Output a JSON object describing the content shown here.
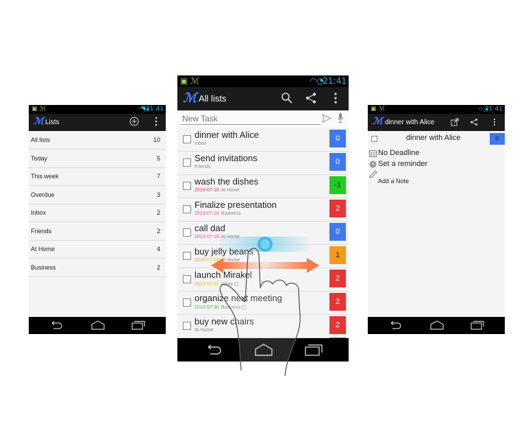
{
  "left_screen": {
    "status": {
      "time": "21:41"
    },
    "actionbar": {
      "title": "Lists"
    },
    "lists": [
      {
        "name": "All lists",
        "count": "10"
      },
      {
        "name": "Today",
        "count": "5"
      },
      {
        "name": "This week",
        "count": "7"
      },
      {
        "name": "Overdue",
        "count": "3"
      },
      {
        "name": "Inbox",
        "count": "2"
      },
      {
        "name": "Friends",
        "count": "2"
      },
      {
        "name": "At Home",
        "count": "4"
      },
      {
        "name": "Business",
        "count": "2"
      }
    ]
  },
  "center_screen": {
    "status": {
      "time": "21:41"
    },
    "actionbar": {
      "title": "All lists"
    },
    "new_task": {
      "placeholder": "New Task"
    },
    "tasks": [
      {
        "name": "dinner with Alice",
        "date": "",
        "list": "Inbox",
        "priority": "0",
        "priority_color": "#3f79ef",
        "date_color": ""
      },
      {
        "name": "Send invitations",
        "date": "",
        "list": "Friends",
        "priority": "0",
        "priority_color": "#3f79ef",
        "date_color": ""
      },
      {
        "name": "wash the dishes",
        "date": "2013-07-16",
        "list": "At Home",
        "priority": "-1",
        "priority_color": "#1fcc1f",
        "date_color": "#e0304d"
      },
      {
        "name": "Finalize presentation",
        "date": "2013-07-18",
        "list": "Business",
        "priority": "2",
        "priority_color": "#e63535",
        "date_color": "#e94ca5"
      },
      {
        "name": "call dad",
        "date": "2013-07-18",
        "list": "At Home",
        "priority": "0",
        "priority_color": "#3f79ef",
        "date_color": "#e94ca5"
      },
      {
        "name": "buy jelly beans",
        "date": "2013-07-20",
        "list": "At Home",
        "priority": "1",
        "priority_color": "#f29a1d",
        "date_color": "#f2a922"
      },
      {
        "name": "launch Mirakel",
        "date": "2013-07-21",
        "list": "Inbox",
        "priority": "2",
        "priority_color": "#e63535",
        "date_color": "#f2a922"
      },
      {
        "name": "organize next meeting",
        "date": "2013-07-30",
        "list": "Business",
        "priority": "2",
        "priority_color": "#e63535",
        "date_color": "#3fbf3f"
      },
      {
        "name": "buy new chairs",
        "date": "",
        "list": "At Home",
        "priority": "2",
        "priority_color": "#e63535",
        "date_color": ""
      }
    ]
  },
  "right_screen": {
    "status": {
      "time": "21:41"
    },
    "actionbar": {
      "title": "dinner with Alice"
    },
    "task": {
      "name": "dinner with Alice",
      "priority": "0"
    },
    "deadline": "No Deadline",
    "reminder": "Set a reminder",
    "note": "Add a Note"
  },
  "colors": {
    "accent": "#33b5e5",
    "logo": "#4d7cff",
    "swipe_arrow": "#f47a4a"
  }
}
